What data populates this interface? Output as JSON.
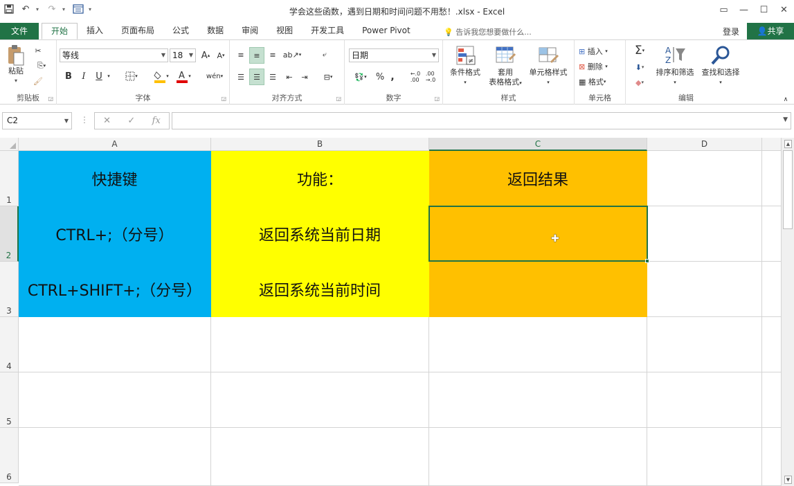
{
  "window": {
    "title": "学会这些函数，遇到日期和时间问题不用愁！.xlsx - Excel",
    "controls": [
      "ribbon-display-icon",
      "minimize-icon",
      "maximize-icon",
      "close-icon"
    ]
  },
  "tabs": {
    "file": "文件",
    "items": [
      "开始",
      "插入",
      "页面布局",
      "公式",
      "数据",
      "审阅",
      "视图",
      "开发工具",
      "Power Pivot"
    ],
    "active": "开始",
    "tell_me": "告诉我您想要做什么...",
    "login": "登录",
    "share": "共享"
  },
  "ribbon": {
    "clipboard": {
      "paste": "粘贴",
      "label": "剪贴板"
    },
    "font": {
      "name": "等线",
      "size": "18",
      "label": "字体",
      "bold": "B",
      "italic": "I",
      "underline": "U"
    },
    "alignment": {
      "label": "对齐方式"
    },
    "number": {
      "format": "日期",
      "label": "数字",
      "percent": "%",
      "comma": ","
    },
    "styles": {
      "conditional": "条件格式",
      "table": "套用表格格式",
      "table_line1": "套用",
      "table_line2": "表格格式",
      "cell_styles": "单元格样式",
      "label": "样式"
    },
    "cells": {
      "insert": "插入",
      "delete": "删除",
      "format": "格式",
      "label": "单元格"
    },
    "editing": {
      "sum": "Σ",
      "sort": "排序和筛选",
      "find": "查找和选择",
      "label": "编辑"
    }
  },
  "formula_bar": {
    "name_box": "C2",
    "fx": "fx",
    "value": ""
  },
  "sheet": {
    "columns": [
      "A",
      "B",
      "C",
      "D"
    ],
    "selected_column": "C",
    "rows": [
      "1",
      "2",
      "3",
      "4",
      "5",
      "6"
    ],
    "selected_row": "2",
    "cells": {
      "A1": "快捷键",
      "B1": "功能：",
      "C1": "返回结果",
      "A2": "CTRL+;（分号）",
      "B2": "返回系统当前日期",
      "C2": "",
      "A3": "CTRL+SHIFT+;（分号）",
      "B3": "返回系统当前时间",
      "C3": ""
    },
    "colors": {
      "blue": "#00b0f0",
      "yellow": "#ffff00",
      "orange": "#ffc000",
      "accent": "#217346"
    }
  }
}
